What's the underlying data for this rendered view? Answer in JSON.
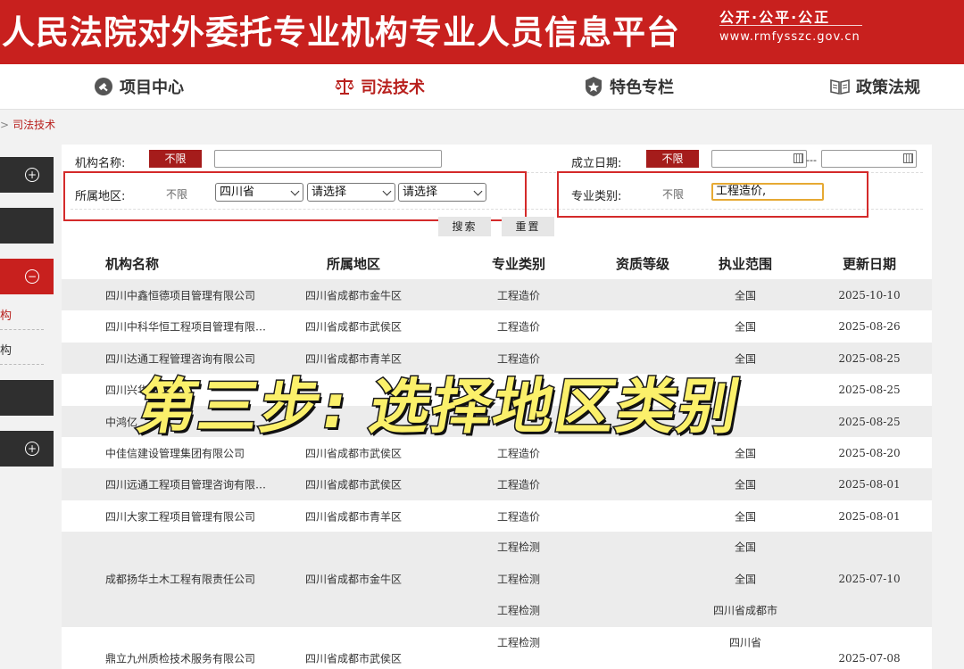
{
  "banner": {
    "title": "人民法院对外委托专业机构专业人员信息平台",
    "slogan": "公开·公平·公正",
    "url": "www.rmfysszc.gov.cn"
  },
  "nav": {
    "items": [
      {
        "label": "项目中心",
        "icon": "gavel-icon"
      },
      {
        "label": "司法技术",
        "icon": "scales-icon",
        "active": true
      },
      {
        "label": "特色专栏",
        "icon": "badge-icon"
      },
      {
        "label": "政策法规",
        "icon": "book-icon"
      }
    ]
  },
  "breadcrumb": {
    "separator": ">",
    "current": "司法技术"
  },
  "sidebar": {
    "items": [
      "构",
      "构"
    ]
  },
  "filters": {
    "org_name_label": "机构名称:",
    "org_name_btn": "不限",
    "org_name_value": "",
    "date_label": "成立日期:",
    "date_btn": "不限",
    "date_sep": "---",
    "region_label": "所属地区:",
    "region_nolimit": "不限",
    "province": "四川省",
    "city": "请选择",
    "district": "请选择",
    "category_label": "专业类别:",
    "category_nolimit": "不限",
    "category_value": "工程造价,",
    "search_btn": "搜索",
    "reset_btn": "重置"
  },
  "table": {
    "headers": [
      "机构名称",
      "所属地区",
      "专业类别",
      "资质等级",
      "执业范围",
      "更新日期"
    ],
    "rows": [
      {
        "name": "四川中鑫恒德项目管理有限公司",
        "region": "四川省成都市金牛区",
        "category": "工程造价",
        "scope": "全国",
        "date": "2025-10-10"
      },
      {
        "name": "四川中科华恒工程项目管理有限…",
        "region": "四川省成都市武侯区",
        "category": "工程造价",
        "scope": "全国",
        "date": "2025-08-26"
      },
      {
        "name": "四川达通工程管理咨询有限公司",
        "region": "四川省成都市青羊区",
        "category": "工程造价",
        "scope": "全国",
        "date": "2025-08-25"
      },
      {
        "name": "四川兴华",
        "region": "",
        "category": "",
        "scope": "",
        "date": "2025-08-25"
      },
      {
        "name": "中鸿亿",
        "region": "",
        "category": "",
        "scope": "",
        "date": "2025-08-25"
      },
      {
        "name": "中佳信建设管理集团有限公司",
        "region": "四川省成都市武侯区",
        "category": "工程造价",
        "scope": "全国",
        "date": "2025-08-20"
      },
      {
        "name": "四川远通工程项目管理咨询有限…",
        "region": "四川省成都市武侯区",
        "category": "工程造价",
        "scope": "全国",
        "date": "2025-08-01"
      },
      {
        "name": "四川大家工程项目管理有限公司",
        "region": "四川省成都市青羊区",
        "category": "工程造价",
        "scope": "全国",
        "date": "2025-08-01"
      }
    ],
    "multi_row_1": {
      "name": "成都扬华土木工程有限责任公司",
      "region": "四川省成都市金牛区",
      "categories": [
        "工程检测",
        "工程检测",
        "工程检测"
      ],
      "scopes": [
        "全国",
        "全国",
        "四川省成都市"
      ],
      "date": "2025-07-10"
    },
    "multi_row_2": {
      "name": "鼎立九州质检技术服务有限公司",
      "region": "四川省成都市武侯区",
      "categories": [
        "工程检测"
      ],
      "scopes": [
        "四川省"
      ],
      "date": "2025-07-08"
    }
  },
  "overlay": {
    "caption": "第三步: 选择地区类别"
  },
  "colors": {
    "brand_red": "#c8201e",
    "button_red": "#a51c1b",
    "highlight_border": "#d42a2a",
    "caption_yellow": "#fbf06a"
  }
}
